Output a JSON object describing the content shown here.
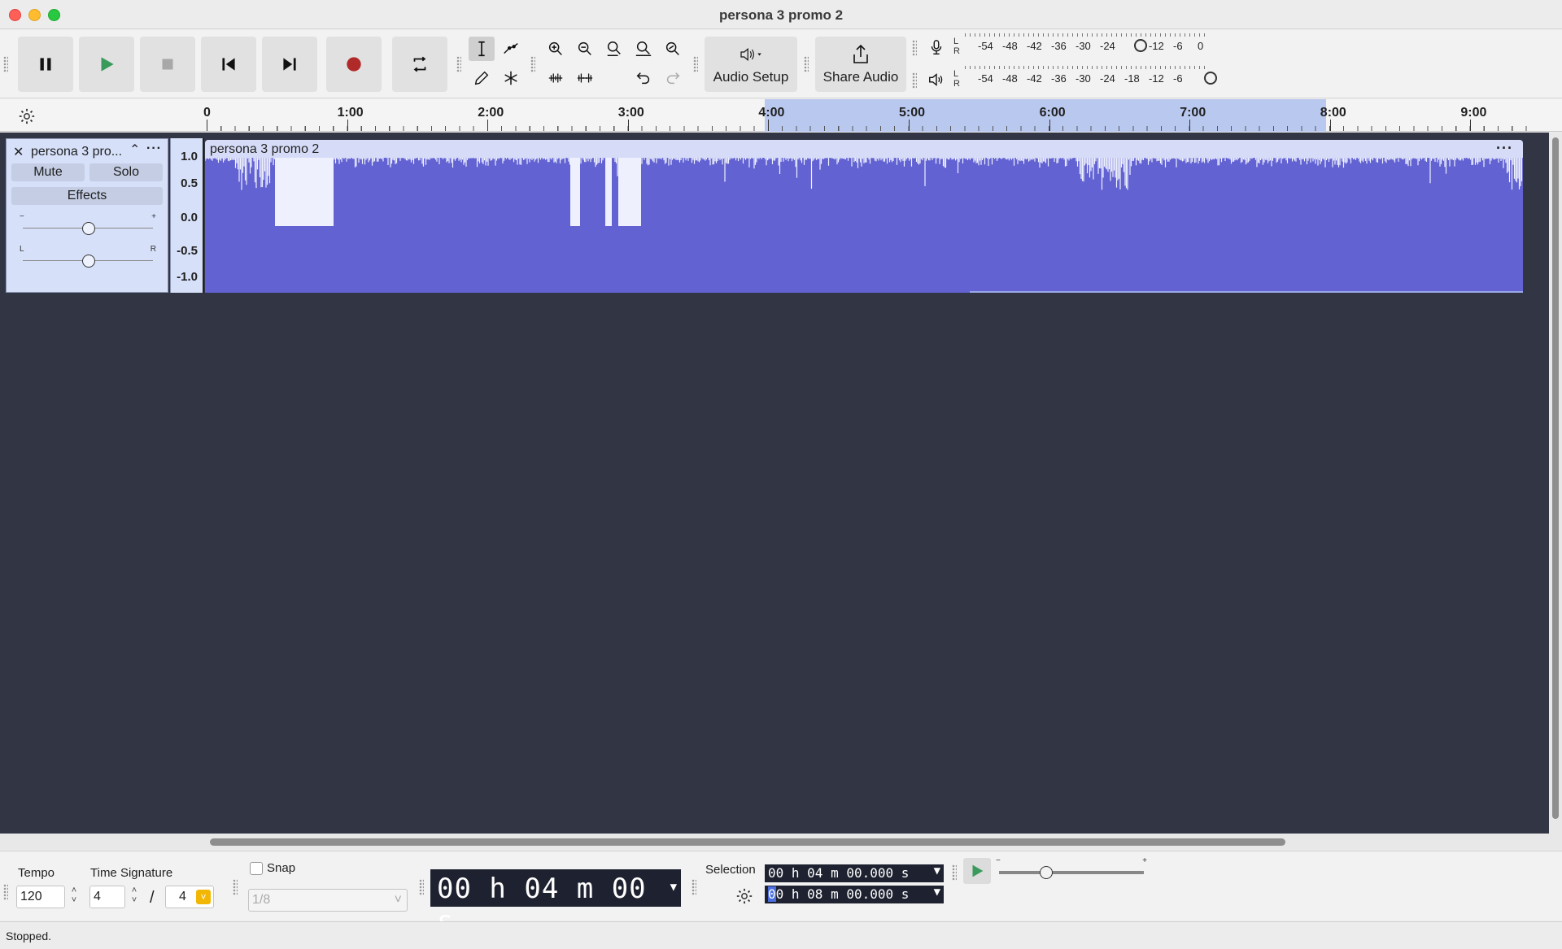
{
  "window": {
    "title": "persona 3 promo 2"
  },
  "toolbar": {
    "audio_setup_label": "Audio Setup",
    "share_audio_label": "Share Audio",
    "meter_labels": [
      "-54",
      "-48",
      "-42",
      "-36",
      "-30",
      "-24",
      "-18",
      "-12",
      "-6",
      "0"
    ],
    "meter_lr": "L\nR"
  },
  "ruler": {
    "labels": [
      "0",
      "1:00",
      "2:00",
      "3:00",
      "4:00",
      "5:00",
      "6:00",
      "7:00",
      "8:00",
      "9:00"
    ]
  },
  "track": {
    "name": "persona 3 pro...",
    "mute_label": "Mute",
    "solo_label": "Solo",
    "effects_label": "Effects",
    "gain_minus": "−",
    "gain_plus": "+",
    "pan_left": "L",
    "pan_right": "R",
    "scale": [
      "1.0",
      "0.5",
      "0.0",
      "-0.5",
      "-1.0"
    ],
    "clip_title": "persona 3 promo 2",
    "clip_menu": "···"
  },
  "bottom": {
    "tempo_label": "Tempo",
    "tempo_value": "120",
    "timesig_label": "Time Signature",
    "timesig_num": "4",
    "timesig_sep": "/",
    "timesig_den": "4",
    "snap_label": "Snap",
    "snap_value": "1/8",
    "time_display": "00 h 04 m 00 s",
    "selection_label": "Selection",
    "selection_start": "00 h 04 m 00.000 s",
    "selection_end_first": "0",
    "selection_end_rest": "0 h 08 m 00.000 s",
    "play_speed_minus": "−",
    "play_speed_plus": "+"
  },
  "status": {
    "text": "Stopped."
  },
  "colors": {
    "waveform": "#6262d2",
    "track_bg": "#323544",
    "selection": "#b9c8ef",
    "record": "#b02a2a",
    "play": "#2e8b57"
  }
}
